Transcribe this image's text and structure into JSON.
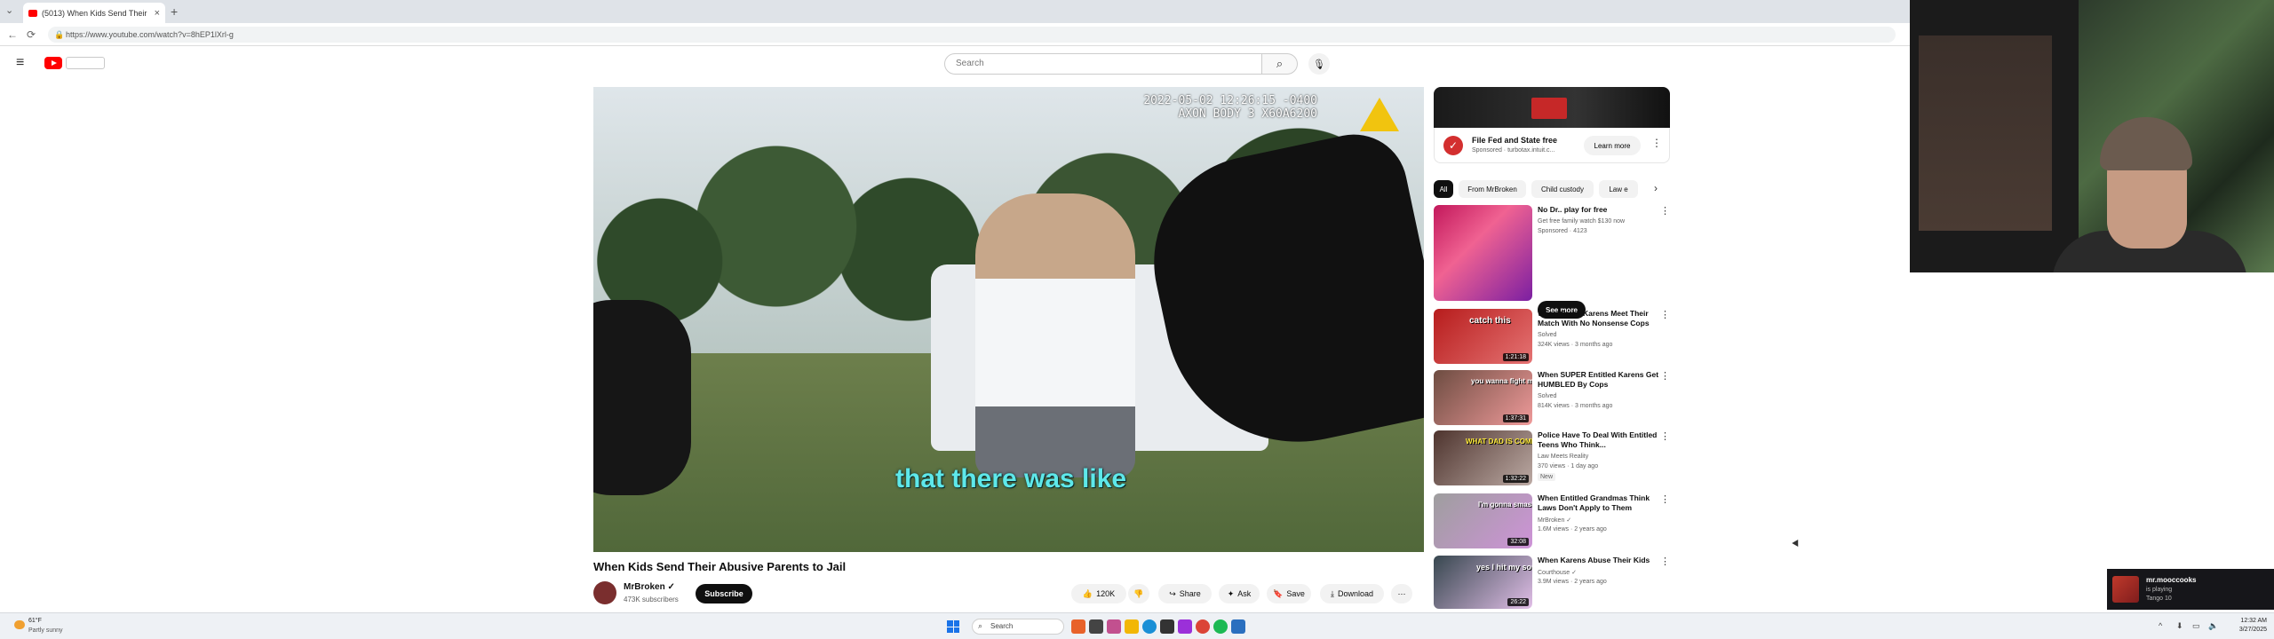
{
  "browser": {
    "tab_title": "(5013) When Kids Send Their",
    "tab_close": "×",
    "new_tab": "+",
    "url": "https://www.youtube.com/watch?v=8hEP1lXrl-g",
    "back": "←",
    "reload": "⟳",
    "tab_menu": "⌄"
  },
  "header": {
    "hamburger": "≡",
    "search_placeholder": "Search",
    "search_icon": "⌕",
    "mic_icon": "🎙"
  },
  "video": {
    "timestamp_line1": "2022-05-02 12:26:15 -0400",
    "timestamp_line2": "AXON BODY 3 X60A6200",
    "caption": "that there was like",
    "title": "When Kids Send Their Abusive Parents to Jail",
    "channel": "MrBroken ✓",
    "subscribers": "473K subscribers",
    "subscribe_label": "Subscribe",
    "likes": "120K",
    "share_label": "Share",
    "ask_label": "Ask",
    "save_label": "Save",
    "download_label": "Download",
    "more": "⋯"
  },
  "ad": {
    "title": "File Fed and State free",
    "sponsor": "Sponsored · turbotax.intuit.c...",
    "learn_more": "Learn more",
    "more": "⋮"
  },
  "chips": [
    "All",
    "From MrBroken",
    "Child custody",
    "Law e"
  ],
  "chip_next": "›",
  "recommendations": [
    {
      "title": "No Dr.. play for free",
      "channel": "Get free family watch $130 now",
      "meta": "Sponsored · 4123",
      "duration": "",
      "thumb_text": "",
      "badge": "",
      "see_more": "See more"
    },
    {
      "title": "When Crazy Karens Meet Their Match With No Nonsense Cops",
      "channel": "Solved",
      "meta": "324K views · 3 months ago",
      "duration": "1:21:18",
      "thumb_text": "catch this"
    },
    {
      "title": "When SUPER Entitled Karens Get HUMBLED By Cops",
      "channel": "Solved",
      "meta": "814K views · 3 months ago",
      "duration": "1:37:31",
      "thumb_text": "you wanna fight me?"
    },
    {
      "title": "Police Have To Deal With Entitled Teens Who Think...",
      "channel": "Law Meets Reality",
      "meta": "370 views · 1 day ago",
      "duration": "1:32:22",
      "thumb_text": "WHAT DAD IS COMING?",
      "badge": "New"
    },
    {
      "title": "When Entitled Grandmas Think Laws Don't Apply to Them",
      "channel": "MrBroken ✓",
      "meta": "1.6M views · 2 years ago",
      "duration": "32:08",
      "thumb_text": "I'm gonna smash you"
    },
    {
      "title": "When Karens Abuse Their Kids",
      "channel": "Courthouse ✓",
      "meta": "3.9M views · 2 years ago",
      "duration": "26:22",
      "thumb_text": "yes I hit my son"
    }
  ],
  "overlay": {
    "name": "mr.mooccooks",
    "status": "is playing",
    "game": "Tango 10"
  },
  "taskbar": {
    "temp": "61°F",
    "weather": "Partly sunny",
    "search": "Search",
    "time": "12:32 AM",
    "date": "3/27/2025"
  }
}
